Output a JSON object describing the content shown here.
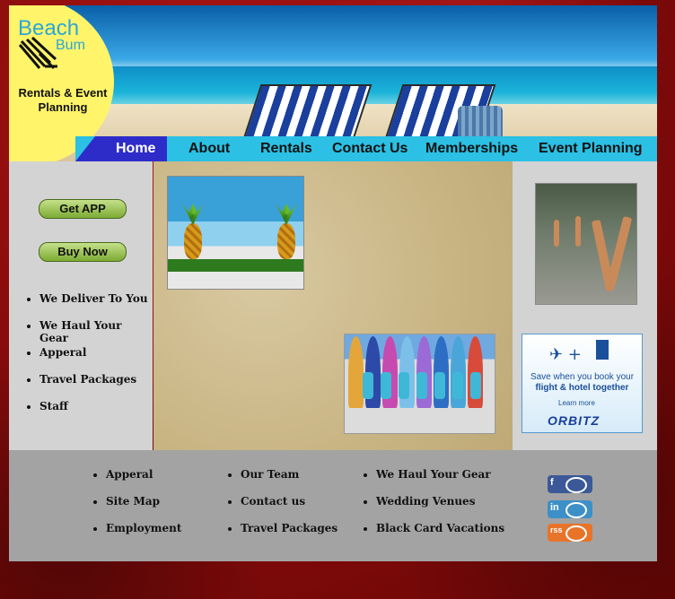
{
  "logo": {
    "line1": "Beach",
    "line2": "Bum",
    "subtitle": "Rentals & Event Planning"
  },
  "nav": [
    "Home",
    "About",
    "Rentals",
    "Contact Us",
    "Memberships",
    "Event Planning"
  ],
  "left": {
    "get_app": "Get  APP",
    "buy_now": "Buy Now",
    "items": [
      "We Deliver To You",
      "We Haul Your Gear",
      "Apperal",
      "Travel Packages",
      "Staff"
    ]
  },
  "ad": {
    "line1": "Save when you book your",
    "line2": "flight & hotel together",
    "more": "Learn more",
    "brand": "ORBITZ"
  },
  "footer": {
    "col1": [
      "Apperal",
      "Site Map",
      "Employment"
    ],
    "col2": [
      "Our Team",
      "Contact us",
      "Travel Packages"
    ],
    "col3": [
      "We Haul Your Gear",
      "Wedding Venues",
      "Black Card Vacations"
    ]
  },
  "social": [
    {
      "label": "f",
      "color": "#3b5998"
    },
    {
      "label": "in",
      "color": "#3d8fc7"
    },
    {
      "label": "rss",
      "color": "#e8742a"
    }
  ],
  "colors": {
    "nav_bg": "#2bc0e4",
    "nav_active": "#2e2cc8",
    "logo_bg": "#fff46a",
    "side_bg": "#d3d3d3",
    "footer_bg": "#a3a3a3"
  }
}
